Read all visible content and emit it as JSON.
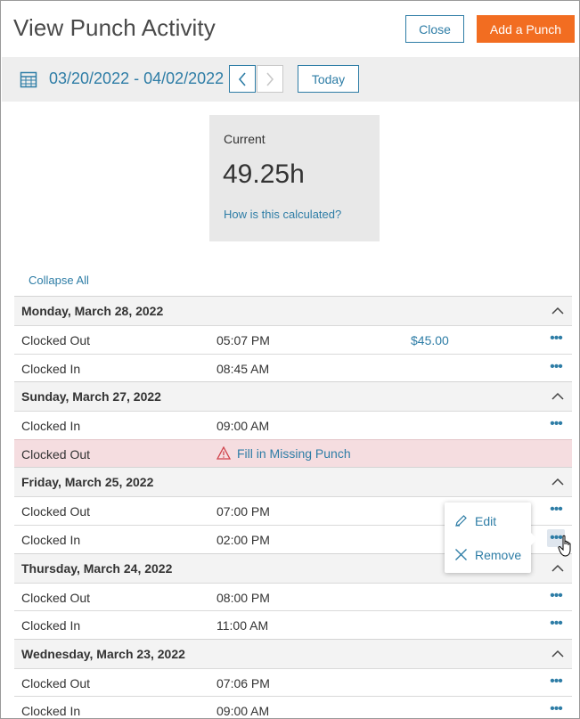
{
  "header": {
    "title": "View Punch Activity",
    "close_label": "Close",
    "add_label": "Add a Punch"
  },
  "datebar": {
    "range": "03/20/2022 - 04/02/2022",
    "today_label": "Today",
    "calendar_icon": "calendar-icon",
    "prev_icon": "chevron-left-icon",
    "next_icon": "chevron-right-icon"
  },
  "summary": {
    "label": "Current",
    "value": "49.25h",
    "link": "How is this calculated?"
  },
  "list": {
    "collapse_label": "Collapse All",
    "toggle_icon": "chevron-up-icon",
    "more_icon": "more-horizontal-icon",
    "days": [
      {
        "title": "Monday, March 28, 2022",
        "rows": [
          {
            "type": "Clocked Out",
            "time": "05:07 PM",
            "amount": "$45.00"
          },
          {
            "type": "Clocked In",
            "time": "08:45 AM"
          }
        ]
      },
      {
        "title": "Sunday, March 27, 2022",
        "rows": [
          {
            "type": "Clocked In",
            "time": "09:00 AM"
          },
          {
            "type": "Clocked Out",
            "missing": "Fill in Missing Punch"
          }
        ]
      },
      {
        "title": "Friday, March 25, 2022",
        "rows": [
          {
            "type": "Clocked Out",
            "time": "07:00 PM"
          },
          {
            "type": "Clocked In",
            "time": "02:00 PM"
          }
        ]
      },
      {
        "title": "Thursday, March 24, 2022",
        "rows": [
          {
            "type": "Clocked Out",
            "time": "08:00 PM"
          },
          {
            "type": "Clocked In",
            "time": "11:00 AM"
          }
        ]
      },
      {
        "title": "Wednesday, March 23, 2022",
        "rows": [
          {
            "type": "Clocked Out",
            "time": "07:06 PM"
          },
          {
            "type": "Clocked In",
            "time": "09:00 AM"
          }
        ]
      }
    ]
  },
  "popup": {
    "edit_label": "Edit",
    "remove_label": "Remove",
    "edit_icon": "pencil-icon",
    "remove_icon": "close-icon"
  },
  "colors": {
    "accent": "#2e7da6",
    "primary_button": "#f26d21",
    "missing_row": "#f5dde0",
    "warning_icon": "#d0434b"
  }
}
